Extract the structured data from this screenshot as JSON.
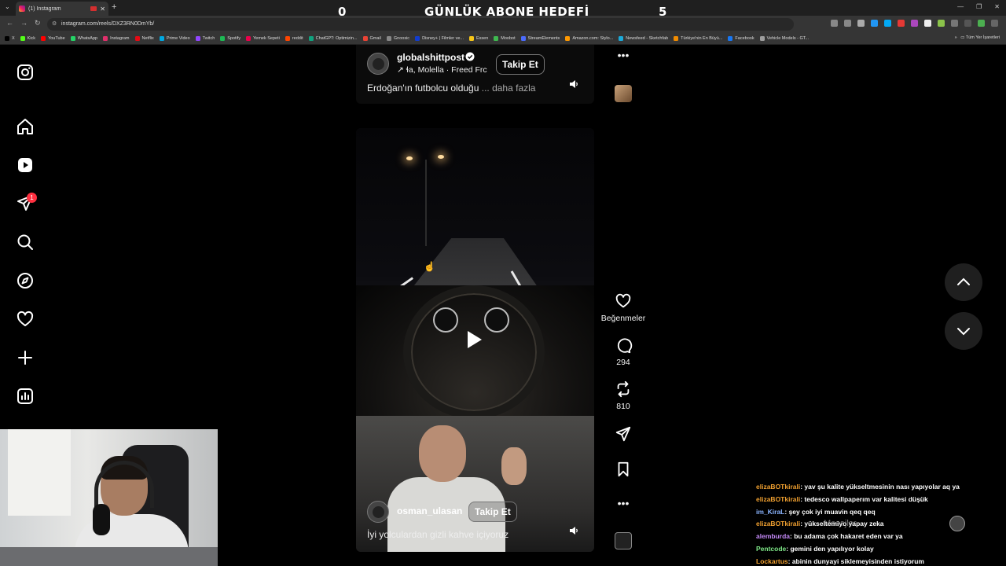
{
  "browser": {
    "tab_title": "(1) Instagram",
    "url": "instagram.com/reels/DXZ3RN0DmYb/",
    "bookmarks": [
      {
        "label": "X",
        "color": "#000000"
      },
      {
        "label": "Kick",
        "color": "#53fc18"
      },
      {
        "label": "YouTube",
        "color": "#ff0000"
      },
      {
        "label": "WhatsApp",
        "color": "#25d366"
      },
      {
        "label": "Instagram",
        "color": "#e1306c"
      },
      {
        "label": "Netflix",
        "color": "#e50914"
      },
      {
        "label": "Prime Video",
        "color": "#00a8e1"
      },
      {
        "label": "Twitch",
        "color": "#9146ff"
      },
      {
        "label": "Spotify",
        "color": "#1db954"
      },
      {
        "label": "Yemek Sepeti",
        "color": "#ea004b"
      },
      {
        "label": "reddit",
        "color": "#ff4500"
      },
      {
        "label": "ChatGPT: Optimizin...",
        "color": "#10a37f"
      },
      {
        "label": "Gmail",
        "color": "#ea4335"
      },
      {
        "label": "Gnoosic",
        "color": "#888888"
      },
      {
        "label": "Disney+ | Filmler ve...",
        "color": "#113ccf"
      },
      {
        "label": "Essen",
        "color": "#f5c518"
      },
      {
        "label": "Moobot",
        "color": "#3fb950"
      },
      {
        "label": "StreamElements",
        "color": "#4b6bfb"
      },
      {
        "label": "Amazon.com: Stylo...",
        "color": "#ff9900"
      },
      {
        "label": "Newsfeed - Sketchfab",
        "color": "#1caad9"
      },
      {
        "label": "Türkiye'nin En Büyü...",
        "color": "#f28c00"
      },
      {
        "label": "Facebook",
        "color": "#1877f2"
      },
      {
        "label": "Vehicle Models - GT...",
        "color": "#9e9e9e"
      }
    ],
    "bookmarks_more": "»",
    "all_bookmarks": "Tüm Yer İşaretleri"
  },
  "stream_overlay": {
    "title": "GÜNLÜK ABONE HEDEFİ",
    "left_count": "0",
    "right_count": "5"
  },
  "sidebar": {
    "notification_count": "1",
    "items": [
      "instagram-logo",
      "home",
      "reels",
      "messages",
      "search",
      "explore",
      "notifications",
      "create",
      "dashboard"
    ]
  },
  "reel_previous": {
    "username": "globalshittpost",
    "audio": "↗ ɬa, Molella · Freed Frc",
    "follow_label": "Takip Et",
    "caption": "Erdoğan'ın futbolcu olduğu",
    "more_label": "... daha fazla"
  },
  "reel_current": {
    "username": "osman_ulasan",
    "follow_label": "Takip Et",
    "caption": "İyi yolculardan gizli kahve içiyoruz"
  },
  "actions": {
    "likes_label": "Beğenmeler",
    "comments": "294",
    "reposts": "810"
  },
  "chat": {
    "lines": [
      {
        "user": "elizaBOTkirali",
        "text": ": yav şu kalite yükseltmesinin nası yapıyolar aq ya",
        "color": "#f0a030"
      },
      {
        "user": "elizaBOTkirali",
        "text": ": tedesco wallpaperım var kalitesi düşük",
        "color": "#f0a030"
      },
      {
        "user": "im_KiraL",
        "text": ": şey çok iyi muavin qeq qeq",
        "color": "#8ab4ff"
      },
      {
        "user": "elizaBOTkirali",
        "text": ": yükseltemiyo yapay zeka",
        "color": "#f0a030"
      },
      {
        "user": "alemburda",
        "text": ": bu adama çok hakaret eden var ya",
        "color": "#c58af9"
      },
      {
        "user": "Pentcode",
        "text": ": gemini den yapılıyor kolay",
        "color": "#7ee787"
      },
      {
        "user": "Lockartus",
        "text": ": abinin dunyayi siklemeyisinden istiyorum",
        "color": "#f0a030"
      }
    ],
    "message_placeholder": "Mesajlar"
  },
  "colors": {
    "background": "#000000",
    "notification_badge": "#ff3040",
    "action_bar_button": "#1f1f1f"
  }
}
